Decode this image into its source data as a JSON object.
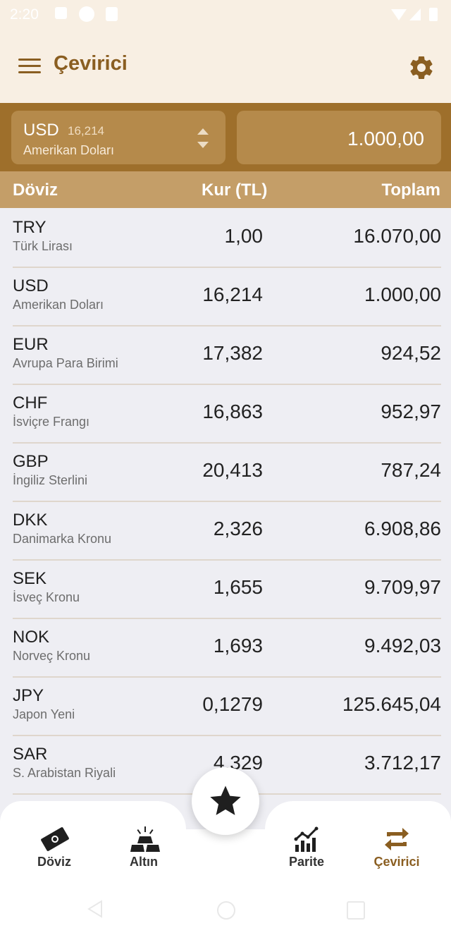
{
  "status_bar": {
    "time": "2:20"
  },
  "app_bar": {
    "title": "Çevirici"
  },
  "converter": {
    "currency_code": "USD",
    "currency_rate": "16,214",
    "currency_name": "Amerikan Doları",
    "amount": "1.000,00"
  },
  "table": {
    "headers": {
      "currency": "Döviz",
      "rate": "Kur (TL)",
      "total": "Toplam"
    },
    "rows": [
      {
        "code": "TRY",
        "name": "Türk Lirası",
        "rate": "1,00",
        "total": "16.070,00"
      },
      {
        "code": "USD",
        "name": "Amerikan Doları",
        "rate": "16,214",
        "total": "1.000,00"
      },
      {
        "code": "EUR",
        "name": "Avrupa Para Birimi",
        "rate": "17,382",
        "total": "924,52"
      },
      {
        "code": "CHF",
        "name": "İsviçre Frangı",
        "rate": "16,863",
        "total": "952,97"
      },
      {
        "code": "GBP",
        "name": "İngiliz Sterlini",
        "rate": "20,413",
        "total": "787,24"
      },
      {
        "code": "DKK",
        "name": "Danimarka Kronu",
        "rate": "2,326",
        "total": "6.908,86"
      },
      {
        "code": "SEK",
        "name": "İsveç Kronu",
        "rate": "1,655",
        "total": "9.709,97"
      },
      {
        "code": "NOK",
        "name": "Norveç Kronu",
        "rate": "1,693",
        "total": "9.492,03"
      },
      {
        "code": "JPY",
        "name": "Japon Yeni",
        "rate": "0,1279",
        "total": "125.645,04"
      },
      {
        "code": "SAR",
        "name": "S. Arabistan Riyali",
        "rate": "4,329",
        "total": "3.712,17"
      }
    ]
  },
  "bottom_nav": {
    "items": [
      {
        "label": "Döviz",
        "icon": "banknote-icon"
      },
      {
        "label": "Altın",
        "icon": "gold-bars-icon"
      },
      {
        "label": "Parite",
        "icon": "chart-icon"
      },
      {
        "label": "Çevirici",
        "icon": "swap-icon"
      }
    ],
    "fab_icon": "star-icon"
  },
  "colors": {
    "brand": "#8a5e21",
    "header_bg": "#f8efe3",
    "converter_bg": "#9e6f2b",
    "table_header_bg": "#c49e68"
  }
}
